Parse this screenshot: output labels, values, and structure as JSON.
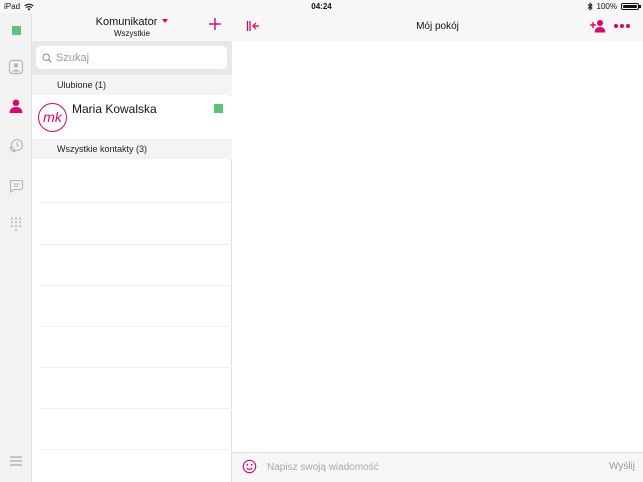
{
  "status_bar": {
    "device": "iPad",
    "time": "04:24",
    "battery": "100%"
  },
  "colors": {
    "accent": "#e0006e",
    "presence_available": "#5ac47c",
    "rail_icon": "#b5b5b5"
  },
  "rail": {
    "items": [
      {
        "name": "presence-status",
        "icon": "green-square-icon"
      },
      {
        "name": "profile",
        "icon": "profile-card-icon"
      },
      {
        "name": "contacts",
        "icon": "person-icon",
        "active": true
      },
      {
        "name": "call-history",
        "icon": "clock-phone-icon"
      },
      {
        "name": "chats",
        "icon": "chat-bubble-icon"
      },
      {
        "name": "dialpad",
        "icon": "dialpad-icon"
      },
      {
        "name": "menu",
        "icon": "hamburger-icon"
      }
    ]
  },
  "list_panel": {
    "title": "Komunikator",
    "subtitle": "Wszystkie",
    "search_placeholder": "Szukaj",
    "favorites_header": "Ulubione (1)",
    "all_contacts_header": "Wszystkie kontakty (3)",
    "contacts": [
      {
        "initials": "mk",
        "name": "Maria Kowalska",
        "status": "available"
      }
    ]
  },
  "chat_panel": {
    "title": "Mój pokój",
    "message_placeholder": "Napisz swoją wiadomość",
    "send_label": "Wyślij"
  }
}
